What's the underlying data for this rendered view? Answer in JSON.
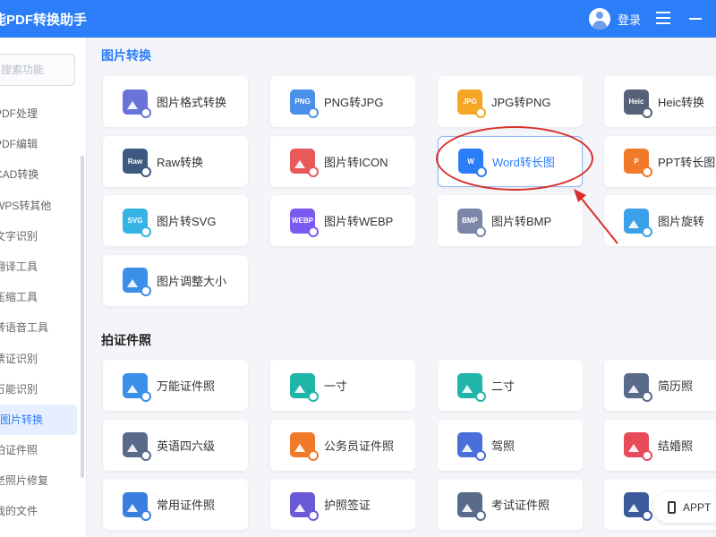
{
  "header": {
    "title": "能PDF转换助手",
    "login": "登录"
  },
  "sidebar": {
    "search_placeholder": "搜索功能",
    "items": [
      {
        "label": "PDF处理",
        "active": false
      },
      {
        "label": "PDF编辑",
        "active": false
      },
      {
        "label": "CAD转换",
        "active": false
      },
      {
        "label": "WPS转其他",
        "active": false
      },
      {
        "label": "文字识别",
        "active": false
      },
      {
        "label": "翻译工具",
        "active": false
      },
      {
        "label": "压缩工具",
        "active": false
      },
      {
        "label": "转语音工具",
        "active": false
      },
      {
        "label": "票证识别",
        "active": false
      },
      {
        "label": "万能识别",
        "active": false
      },
      {
        "label": "图片转换",
        "active": true
      },
      {
        "label": "拍证件照",
        "active": false
      },
      {
        "label": "老照片修复",
        "active": false
      },
      {
        "label": "我的文件",
        "active": false
      }
    ]
  },
  "sections": {
    "image": {
      "title": "图片转换",
      "cards": [
        {
          "label": "图片格式转换",
          "icon": "image-format-icon",
          "color": "#6a73d8",
          "tag": ""
        },
        {
          "label": "PNG转JPG",
          "icon": "png-icon",
          "color": "#4a8fe8",
          "tag": "PNG"
        },
        {
          "label": "JPG转PNG",
          "icon": "jpg-icon",
          "color": "#f5a623",
          "tag": "JPG"
        },
        {
          "label": "Heic转换",
          "icon": "heic-icon",
          "color": "#556277",
          "tag": "Heic"
        },
        {
          "label": "Raw转换",
          "icon": "raw-icon",
          "color": "#3d5a80",
          "tag": "Raw"
        },
        {
          "label": "图片转ICON",
          "icon": "image-to-icon-icon",
          "color": "#e85a5a",
          "tag": ""
        },
        {
          "label": "Word转长图",
          "icon": "word-icon",
          "color": "#2c7ef8",
          "tag": "W"
        },
        {
          "label": "PPT转长图",
          "icon": "ppt-icon",
          "color": "#f07a2a",
          "tag": "P"
        },
        {
          "label": "图片转SVG",
          "icon": "svg-icon",
          "color": "#34b3e4",
          "tag": "SVG"
        },
        {
          "label": "图片转WEBP",
          "icon": "webp-icon",
          "color": "#7a5af0",
          "tag": "WEBP"
        },
        {
          "label": "图片转BMP",
          "icon": "bmp-icon",
          "color": "#7b87a8",
          "tag": "BMP"
        },
        {
          "label": "图片旋转",
          "icon": "rotate-icon",
          "color": "#3aa0e8",
          "tag": ""
        },
        {
          "label": "图片调整大小",
          "icon": "resize-icon",
          "color": "#3a8fe8",
          "tag": ""
        }
      ]
    },
    "photo": {
      "title": "拍证件照",
      "cards": [
        {
          "label": "万能证件照",
          "icon": "universal-id-photo-icon",
          "color": "#3a8fe8",
          "tag": ""
        },
        {
          "label": "一寸",
          "icon": "one-inch-icon",
          "color": "#1fb5a8",
          "tag": ""
        },
        {
          "label": "二寸",
          "icon": "two-inch-icon",
          "color": "#1fb5a8",
          "tag": ""
        },
        {
          "label": "简历照",
          "icon": "resume-photo-icon",
          "color": "#5a6a8a",
          "tag": ""
        },
        {
          "label": "英语四六级",
          "icon": "cet-icon",
          "color": "#5a6a8a",
          "tag": ""
        },
        {
          "label": "公务员证件照",
          "icon": "civil-servant-icon",
          "color": "#f07a2a",
          "tag": ""
        },
        {
          "label": "驾照",
          "icon": "driver-license-icon",
          "color": "#4a6fd8",
          "tag": ""
        },
        {
          "label": "结婚照",
          "icon": "marriage-photo-icon",
          "color": "#e84a5a",
          "tag": ""
        },
        {
          "label": "常用证件照",
          "icon": "common-id-photo-icon",
          "color": "#3a7fe0",
          "tag": ""
        },
        {
          "label": "护照签证",
          "icon": "passport-icon",
          "color": "#6a5ad8",
          "tag": ""
        },
        {
          "label": "考试证件照",
          "icon": "exam-photo-icon",
          "color": "#5a6a8a",
          "tag": ""
        },
        {
          "label": "",
          "icon": "extra-photo-icon",
          "color": "#3a5a9a",
          "tag": ""
        }
      ]
    }
  },
  "floating": {
    "app_label": "APPT"
  }
}
